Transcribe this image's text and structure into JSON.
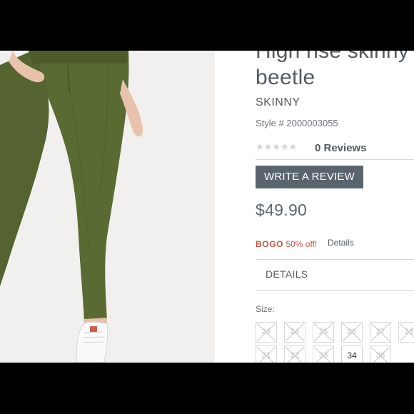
{
  "product": {
    "title_line1": "High rise skinny o",
    "title_line2": "beetle",
    "category": "SKINNY",
    "style": "Style # 2000003055",
    "rating_stars": "★★★★★",
    "reviews": "0 Reviews",
    "review_button": "WRITE A REVIEW",
    "price": "$49.90",
    "promo_code": "BOGO",
    "promo_text": " 50% off!",
    "promo_details": "Details",
    "details_tab": "DETAILS",
    "size_label": "Size:"
  },
  "sizes": [
    {
      "label": "23",
      "available": false
    },
    {
      "label": "24",
      "available": false
    },
    {
      "label": "25",
      "available": false
    },
    {
      "label": "26",
      "available": false
    },
    {
      "label": "27",
      "available": false
    },
    {
      "label": "28",
      "available": false
    },
    {
      "label": "31",
      "available": false
    },
    {
      "label": "32",
      "available": false
    },
    {
      "label": "33",
      "available": false
    },
    {
      "label": "34",
      "available": true
    },
    {
      "label": "36",
      "available": false
    }
  ],
  "colors": {
    "product_color": "#5c6b35",
    "promo": "#c5573e",
    "button": "#5a646c"
  }
}
